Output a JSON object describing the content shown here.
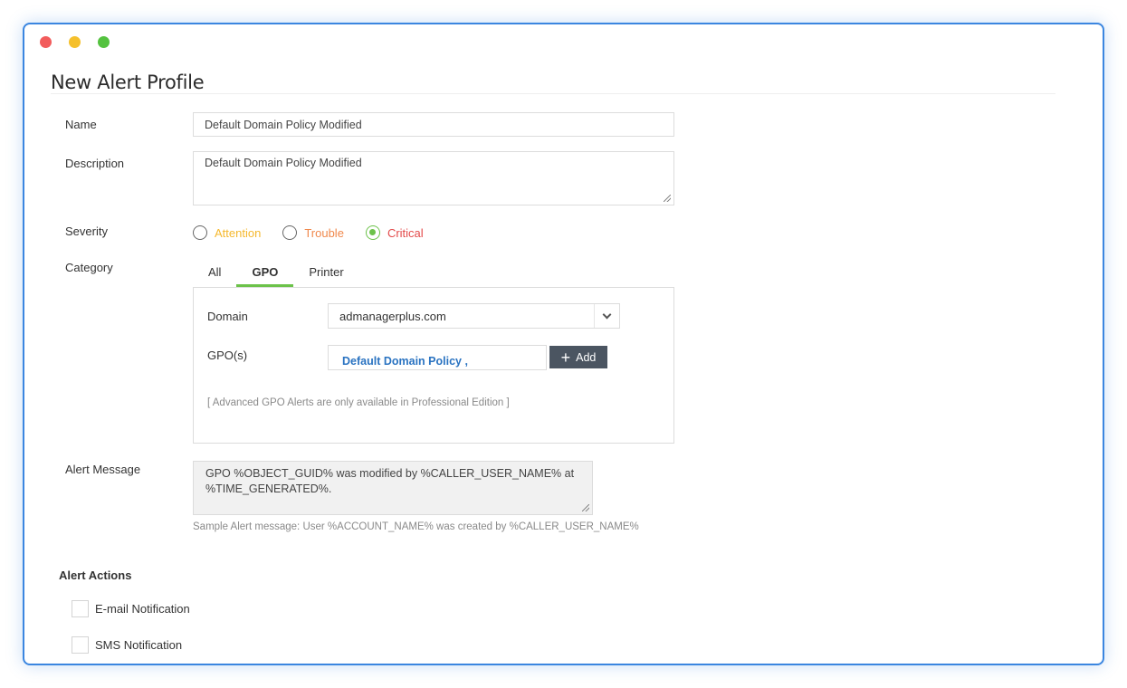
{
  "page": {
    "title": "New Alert Profile"
  },
  "form": {
    "name": {
      "label": "Name",
      "value": "Default Domain Policy Modified"
    },
    "description": {
      "label": "Description",
      "value": "Default Domain Policy Modified"
    },
    "severity": {
      "label": "Severity",
      "options": [
        {
          "label": "Attention",
          "color": "#f5b82e",
          "checked": false
        },
        {
          "label": "Trouble",
          "color": "#f0884c",
          "checked": false
        },
        {
          "label": "Critical",
          "color": "#e34a4a",
          "checked": true
        }
      ]
    },
    "category": {
      "label": "Category",
      "tabs": [
        {
          "label": "All",
          "active": false
        },
        {
          "label": "GPO",
          "active": true
        },
        {
          "label": "Printer",
          "active": false
        }
      ],
      "domain": {
        "label": "Domain",
        "value": "admanagerplus.com"
      },
      "gpos": {
        "label": "GPO(s)",
        "value": "Default Domain Policy ,",
        "add_label": "Add"
      },
      "note": "[ Advanced GPO Alerts are only available in Professional Edition ]"
    },
    "alert_message": {
      "label": "Alert Message",
      "value": "GPO %OBJECT_GUID% was modified by %CALLER_USER_NAME% at %TIME_GENERATED%.",
      "sample": "Sample Alert message: User %ACCOUNT_NAME% was created by %CALLER_USER_NAME%"
    }
  },
  "alert_actions": {
    "title": "Alert Actions",
    "items": [
      {
        "label": "E-mail Notification",
        "checked": false
      },
      {
        "label": "SMS Notification",
        "checked": false
      }
    ]
  },
  "colors": {
    "accent_green": "#6cc24a",
    "window_border": "#3b86e0",
    "link_blue": "#2a73c1",
    "button_dark": "#4b5561"
  }
}
